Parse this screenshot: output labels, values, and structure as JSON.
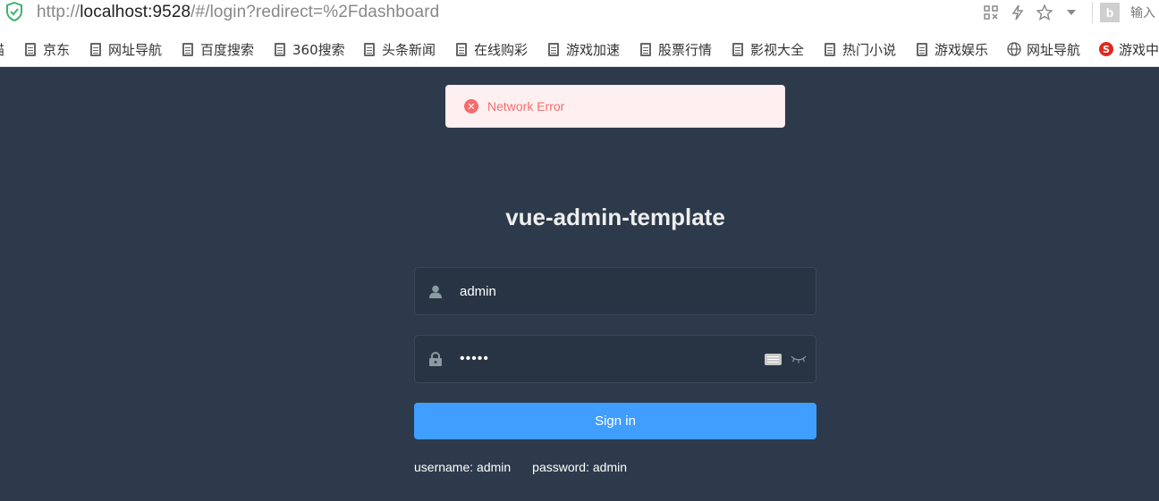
{
  "browser": {
    "url_scheme": "http://",
    "url_host": "localhost:9528",
    "url_path": "/#/login?redirect=%2Fdashboard",
    "search_placeholder": "输入",
    "bookmarks": [
      {
        "label": "猫",
        "icon": "none"
      },
      {
        "label": "京东",
        "icon": "doc-icon"
      },
      {
        "label": "网址导航",
        "icon": "doc-icon"
      },
      {
        "label": "百度搜索",
        "icon": "doc-icon"
      },
      {
        "label": "360搜索",
        "icon": "doc-icon"
      },
      {
        "label": "头条新闻",
        "icon": "doc-icon"
      },
      {
        "label": "在线购彩",
        "icon": "doc-icon"
      },
      {
        "label": "游戏加速",
        "icon": "doc-icon"
      },
      {
        "label": "股票行情",
        "icon": "doc-icon"
      },
      {
        "label": "影视大全",
        "icon": "doc-icon"
      },
      {
        "label": "热门小说",
        "icon": "doc-icon"
      },
      {
        "label": "游戏娱乐",
        "icon": "doc-icon"
      },
      {
        "label": "网址导航",
        "icon": "globe-icon"
      },
      {
        "label": "游戏中",
        "icon": "red-logo-icon"
      }
    ]
  },
  "message": {
    "type": "error",
    "text": "Network Error",
    "icon": "close-circle-icon",
    "color": "#f56c6c"
  },
  "login": {
    "title": "vue-admin-template",
    "username_value": "admin",
    "username_icon": "user-icon",
    "password_value": "•••••",
    "password_icon": "lock-icon",
    "submit_label": "Sign in",
    "tip_username": "username: admin",
    "tip_password": "password: admin",
    "button_color": "#409eff",
    "background_color": "#2d3a4b"
  }
}
